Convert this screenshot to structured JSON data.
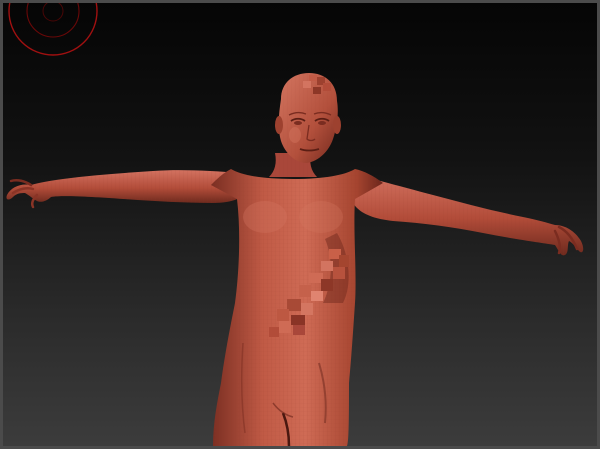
{
  "app": {
    "name": "sculpt-viewport"
  },
  "viewport": {
    "background_top": "#050505",
    "background_bottom": "#3c3c3c",
    "frame_color": "#4b4b4b"
  },
  "model": {
    "material_base": "#b8503d",
    "material_highlight": "#d8735c",
    "material_shadow": "#6a241a",
    "wire_color": "#8a3426"
  },
  "gizmo": {
    "icon": "navigation-gizmo-icon",
    "color": "#a01010"
  }
}
